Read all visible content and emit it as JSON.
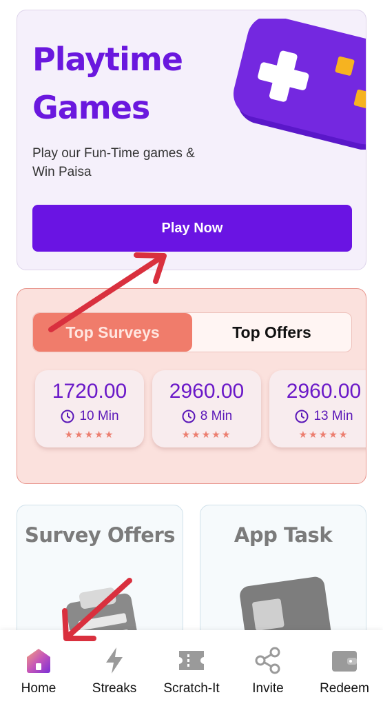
{
  "playtime": {
    "title_line1": "Playtime",
    "title_line2": "Games",
    "subtitle_line1": "Play our Fun-Time games &",
    "subtitle_line2": "Win Paisa",
    "button_label": "Play Now"
  },
  "surveys": {
    "tabs": [
      {
        "label": "Top Surveys",
        "active": true
      },
      {
        "label": "Top Offers",
        "active": false
      }
    ],
    "offers": [
      {
        "amount": "1720.00",
        "time": "10 Min",
        "stars": "★★★★★"
      },
      {
        "amount": "2960.00",
        "time": "8 Min",
        "stars": "★★★★★"
      },
      {
        "amount": "2960.00",
        "time": "13 Min",
        "stars": "★★★★★"
      }
    ]
  },
  "tasks": [
    {
      "title": "Survey Offers"
    },
    {
      "title": "App Task"
    }
  ],
  "nav": [
    {
      "label": "Home",
      "icon": "home-icon",
      "active": true
    },
    {
      "label": "Streaks",
      "icon": "lightning-icon",
      "active": false
    },
    {
      "label": "Scratch-It",
      "icon": "ticket-icon",
      "active": false
    },
    {
      "label": "Invite",
      "icon": "share-icon",
      "active": false
    },
    {
      "label": "Redeem",
      "icon": "wallet-icon",
      "active": false
    }
  ],
  "colors": {
    "brand_purple": "#6a14e3",
    "survey_accent": "#f07c6b",
    "annotation_arrow": "#d9303e"
  }
}
